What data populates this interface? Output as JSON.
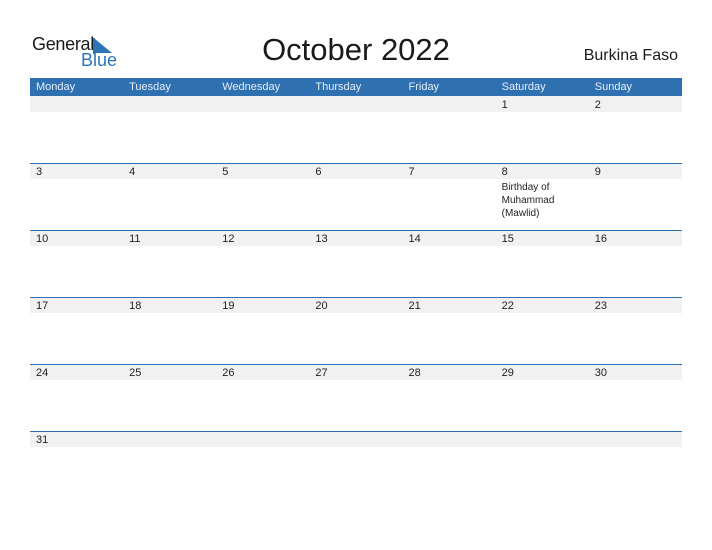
{
  "brand": {
    "word1": "General",
    "word2": "Blue"
  },
  "title": "October 2022",
  "country": "Burkina Faso",
  "colors": {
    "accent": "#2e70b0",
    "strip": "#f1f1f1"
  },
  "weekdays": [
    "Monday",
    "Tuesday",
    "Wednesday",
    "Thursday",
    "Friday",
    "Saturday",
    "Sunday"
  ],
  "weeks": [
    [
      "",
      "",
      "",
      "",
      "",
      "1",
      "2"
    ],
    [
      "3",
      "4",
      "5",
      "6",
      "7",
      "8",
      "9"
    ],
    [
      "10",
      "11",
      "12",
      "13",
      "14",
      "15",
      "16"
    ],
    [
      "17",
      "18",
      "19",
      "20",
      "21",
      "22",
      "23"
    ],
    [
      "24",
      "25",
      "26",
      "27",
      "28",
      "29",
      "30"
    ],
    [
      "31",
      "",
      "",
      "",
      "",
      "",
      ""
    ]
  ],
  "events": [
    {
      "week": 1,
      "day": 5,
      "text": "Birthday of Muhammad (Mawlid)"
    }
  ]
}
